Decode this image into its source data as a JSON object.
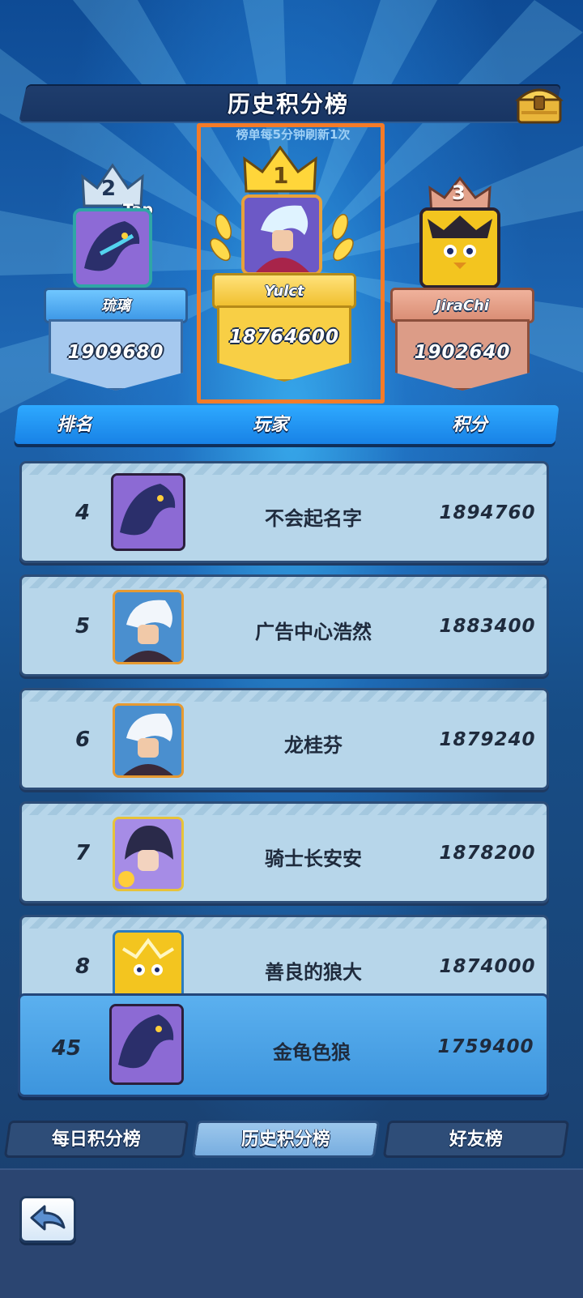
{
  "title": "历史积分榜",
  "refresh_note": "榜单每5分钟刷新1次",
  "podium": [
    {
      "rank": "2",
      "tag": "Tap",
      "name": "琉璃",
      "score": "1909680"
    },
    {
      "rank": "1",
      "name": "Yulct",
      "score": "18764600"
    },
    {
      "rank": "3",
      "name": "JiraChi",
      "score": "1902640"
    }
  ],
  "columns": {
    "rank": "排名",
    "player": "玩家",
    "score": "积分"
  },
  "rows": [
    {
      "rank": "4",
      "name": "不会起名字",
      "score": "1894760"
    },
    {
      "rank": "5",
      "name": "广告中心浩然",
      "score": "1883400"
    },
    {
      "rank": "6",
      "name": "龙桂芬",
      "score": "1879240"
    },
    {
      "rank": "7",
      "name": "骑士长安安",
      "score": "1878200"
    },
    {
      "rank": "8",
      "name": "善良的狼大",
      "score": "1874000"
    }
  ],
  "me": {
    "rank": "45",
    "name": "金龟色狼",
    "score": "1759400"
  },
  "tabs": [
    {
      "label": "每日积分榜",
      "active": false
    },
    {
      "label": "历史积分榜",
      "active": true
    },
    {
      "label": "好友榜",
      "active": false
    }
  ],
  "icons": [
    "treasure-chest-icon",
    "crown-icon",
    "laurel-icon",
    "back-arrow-icon"
  ],
  "colors": {
    "highlight_frame": "#f47b28",
    "header_blue": "#1e8fee",
    "row_bg": "#b7d6ea",
    "me_row": "#4aa0e4"
  }
}
